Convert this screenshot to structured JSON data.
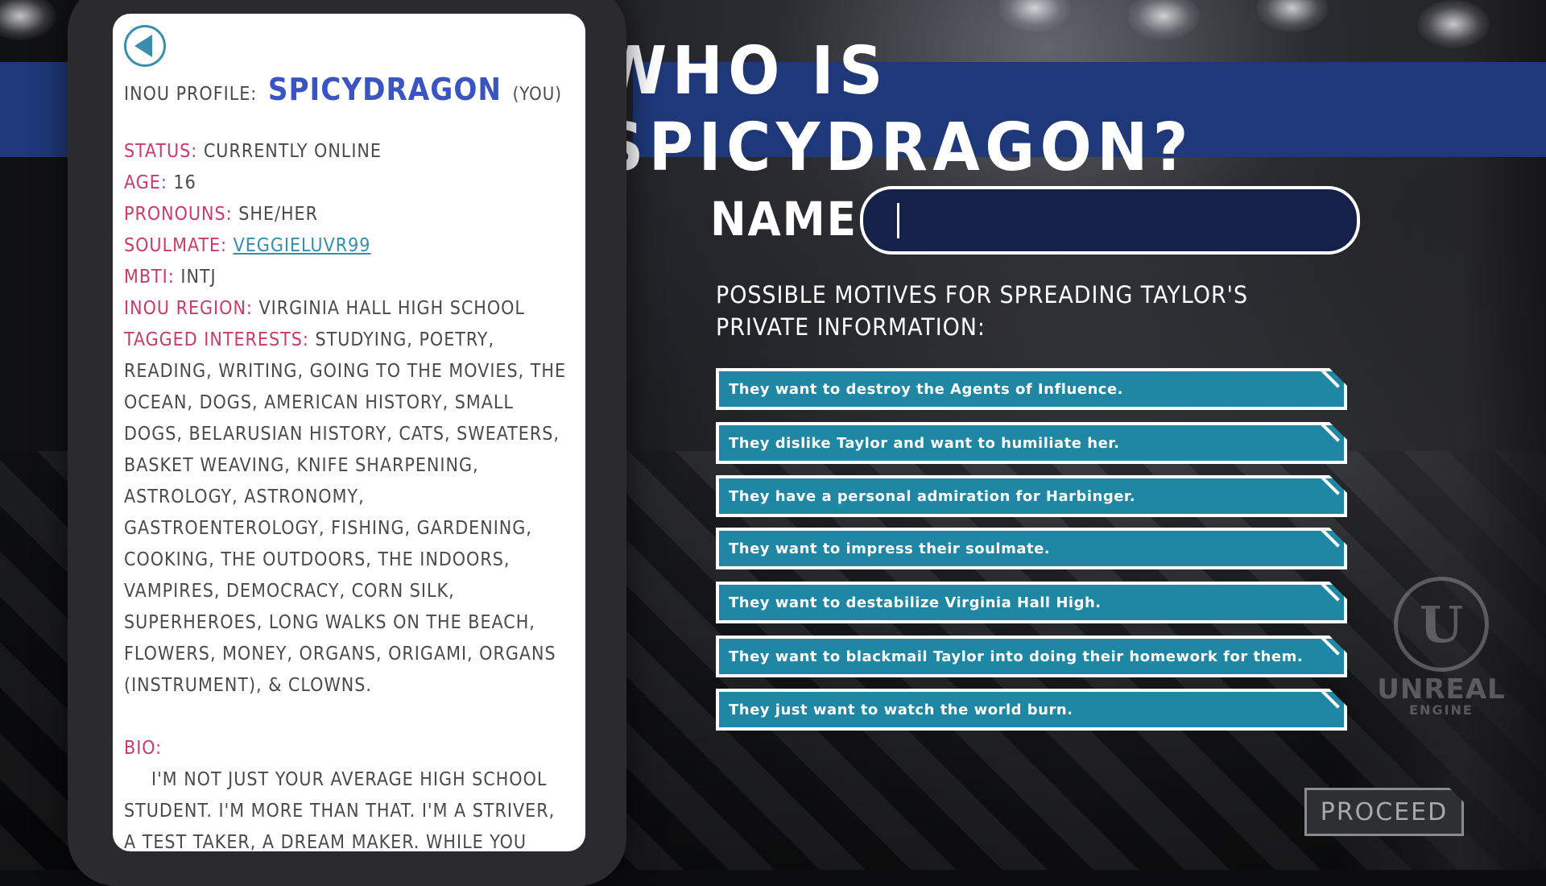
{
  "title": "WHO IS SPICYDRAGON?",
  "profile": {
    "heading_label": "INOU PROFILE:",
    "username": "SPICYDRAGON",
    "you_tag": "(YOU)",
    "fields": [
      {
        "label": "STATUS:",
        "value": "CURRENTLY ONLINE"
      },
      {
        "label": "AGE:",
        "value": "16"
      },
      {
        "label": "PRONOUNS:",
        "value": "SHE/HER"
      },
      {
        "label": "SOULMATE:",
        "value": "VEGGIELUVR99"
      },
      {
        "label": "MBTI:",
        "value": "INTJ"
      },
      {
        "label": "INOU REGION:",
        "value": "VIRGINIA HALL HIGH SCHOOL"
      },
      {
        "label": "TAGGED INTERESTS:",
        "value": "STUDYING, POETRY, READING, WRITING, GOING TO THE MOVIES, THE OCEAN, DOGS, AMERICAN HISTORY, SMALL DOGS, BELARUSIAN HISTORY, CATS, SWEATERS, BASKET WEAVING, KNIFE SHARPENING, ASTROLOGY, ASTRONOMY, GASTROENTEROLOGY, FISHING, GARDENING, COOKING, THE OUTDOORS, THE INDOORS, VAMPIRES, DEMOCRACY, CORN SILK, SUPERHEROES, LONG WALKS ON THE BEACH, FLOWERS, MONEY, ORGANS, ORIGAMI, ORGANS (INSTRUMENT), & CLOWNS."
      }
    ],
    "bio_label": "BIO:",
    "bio_text": "I'M NOT JUST YOUR AVERAGE HIGH SCHOOL STUDENT. I'M MORE THAN THAT. I'M A STRIVER, A TEST TAKER, A DREAM MAKER. WHILE YOU SLEPT, I GRINDED. WHILE YOU PARTIED, I"
  },
  "name_field": {
    "label": "NAME:",
    "value": ""
  },
  "motives_heading": "POSSIBLE MOTIVES FOR SPREADING TAYLOR'S PRIVATE INFORMATION:",
  "motives": [
    "They want to destroy the Agents of Influence.",
    "They dislike Taylor and want to humiliate her.",
    "They have a personal admiration for Harbinger.",
    "They want to impress their soulmate.",
    "They want to destabilize Virginia Hall High.",
    "They want to blackmail Taylor into doing their homework for them.",
    "They just want to watch the world burn."
  ],
  "proceed_label": "PROCEED",
  "watermark": {
    "icon": "unreal-engine-logo-icon",
    "word": "UNREAL",
    "sub": "ENGINE"
  },
  "colors": {
    "banner": "#1e3879",
    "motive_button": "#1f86a3",
    "label_pink": "#cc3a66",
    "username_blue": "#3a55c2",
    "link_teal": "#2f8fb5"
  }
}
